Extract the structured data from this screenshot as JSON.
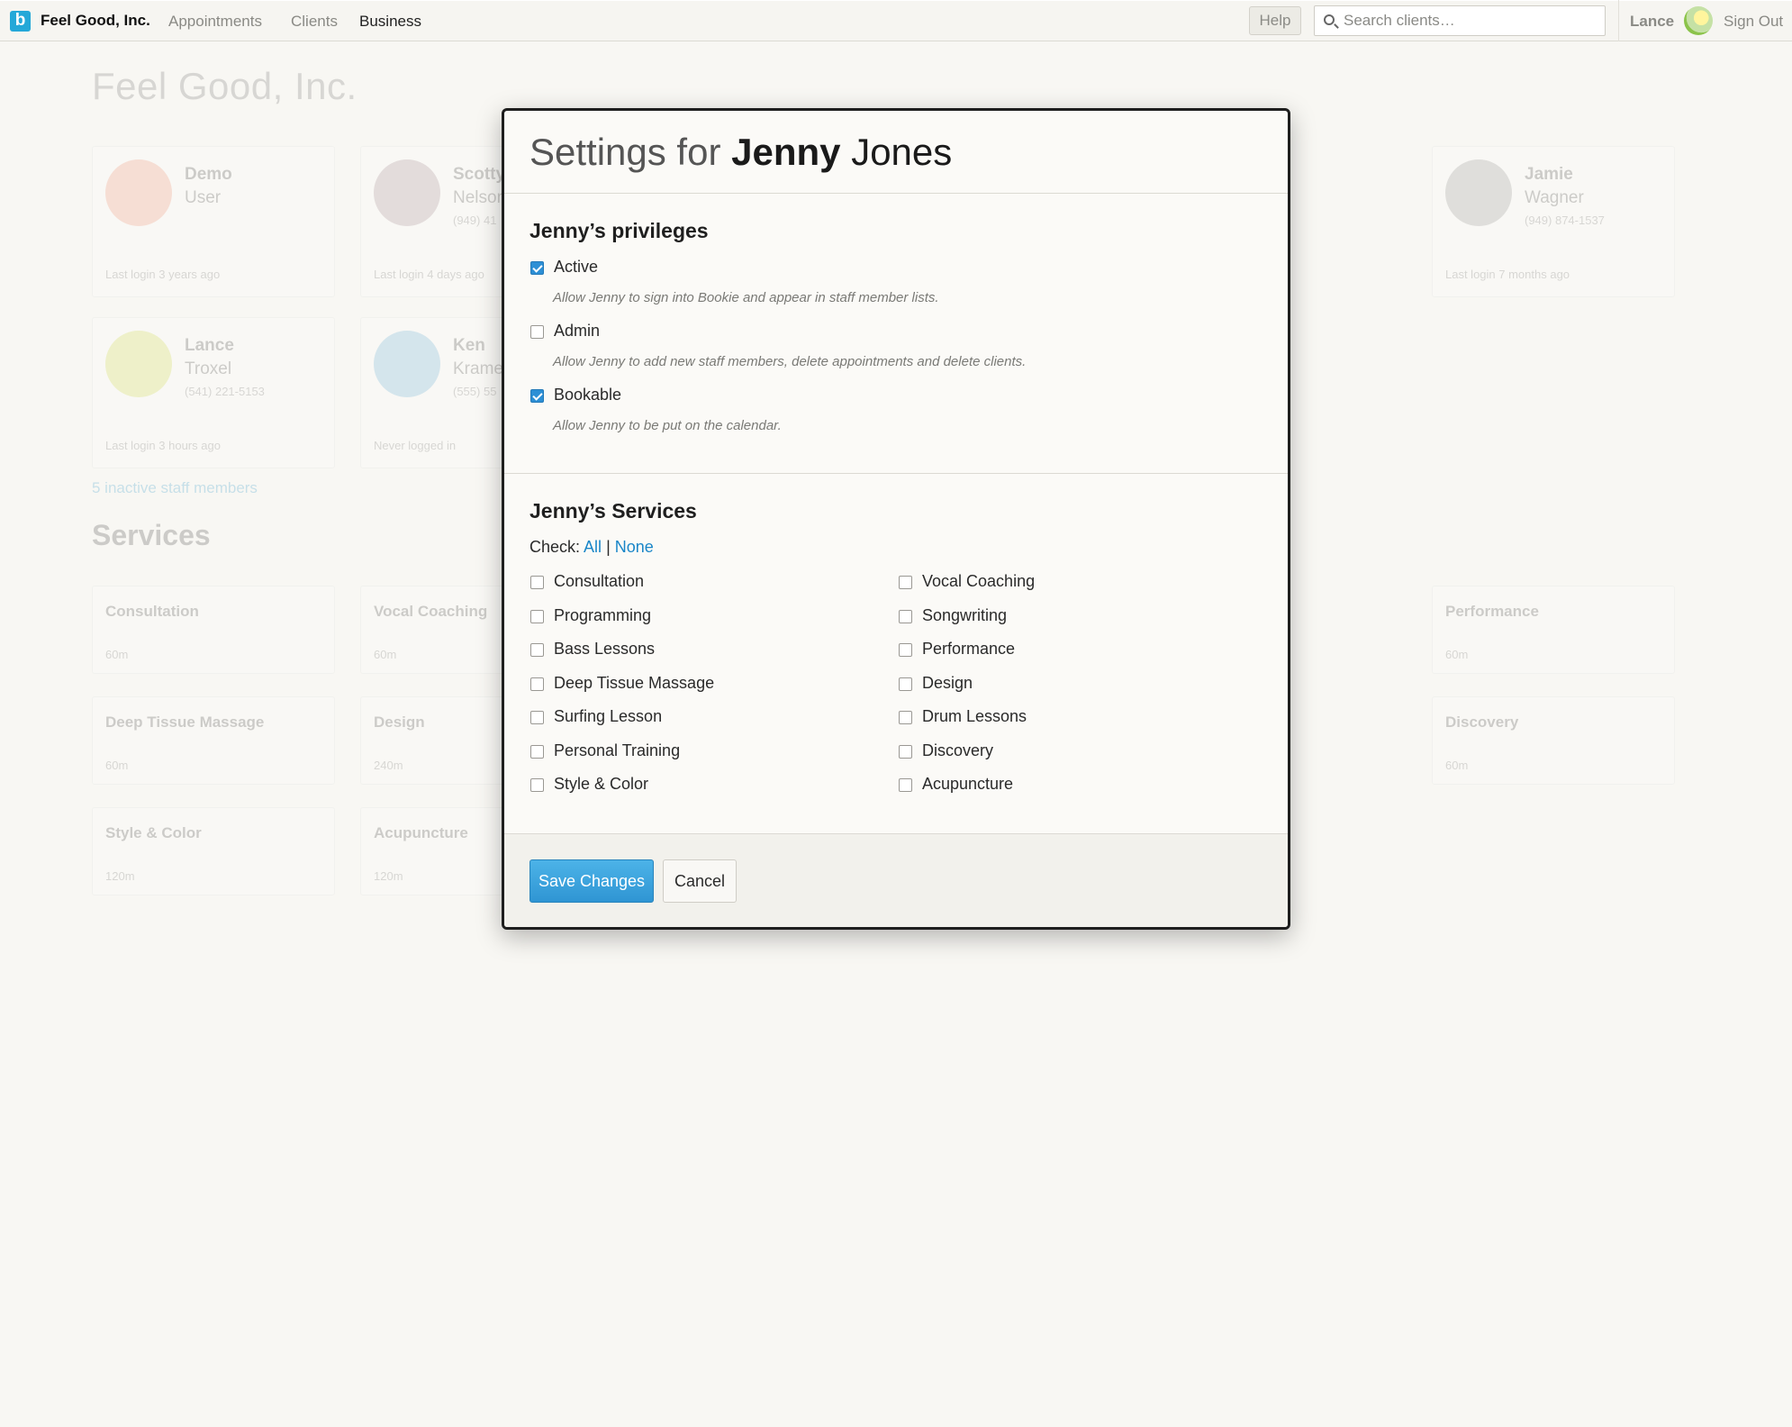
{
  "nav": {
    "logo": "b",
    "brand": "Feel Good, Inc.",
    "links": [
      "Appointments",
      "Clients",
      "Business"
    ],
    "help": "Help",
    "search_placeholder": "Search clients…",
    "user": "Lance",
    "signout": "Sign Out"
  },
  "background": {
    "title": "Feel Good, Inc.",
    "staff": [
      {
        "first": "Demo",
        "last": "User",
        "phone": "",
        "last_login": "Last login 3 years ago"
      },
      {
        "first": "Scotty",
        "last": "Nelson",
        "phone": "(949) 41",
        "last_login": "Last login 4 days ago"
      },
      {
        "first": "Jamie",
        "last": "Wagner",
        "phone": "(949) 874-1537",
        "last_login": "Last login 7 months ago"
      },
      {
        "first": "Lance",
        "last": "Troxel",
        "phone": "(541) 221-5153",
        "last_login": "Last login 3 hours ago"
      },
      {
        "first": "Ken",
        "last": "Kramer",
        "phone": "(555) 55",
        "last_login": "Never logged in"
      }
    ],
    "inactive_link": "5 inactive staff members",
    "services_heading": "Services",
    "services": [
      {
        "name": "Consultation",
        "duration": "60m"
      },
      {
        "name": "Vocal Coaching",
        "duration": "60m"
      },
      {
        "name": "Performance",
        "duration": "60m"
      },
      {
        "name": "Deep Tissue Massage",
        "duration": "60m"
      },
      {
        "name": "Design",
        "duration": "240m"
      },
      {
        "name": "Discovery",
        "duration": "60m"
      },
      {
        "name": "Style & Color",
        "duration": "120m"
      },
      {
        "name": "Acupuncture",
        "duration": "120m"
      }
    ]
  },
  "modal": {
    "title_prefix": "Settings for",
    "first_name": "Jenny",
    "last_name": "Jones",
    "privileges_heading": "Jenny’s privileges",
    "privileges": [
      {
        "label": "Active",
        "checked": true,
        "desc": "Allow Jenny to sign into Bookie and appear in staff member lists."
      },
      {
        "label": "Admin",
        "checked": false,
        "desc": "Allow Jenny to add new staff members, delete appointments and delete clients."
      },
      {
        "label": "Bookable",
        "checked": true,
        "desc": "Allow Jenny to be put on the calendar."
      }
    ],
    "services_heading": "Jenny’s Services",
    "check_label": "Check:",
    "check_all": "All",
    "check_sep": "|",
    "check_none": "None",
    "services_left": [
      "Consultation",
      "Programming",
      "Bass Lessons",
      "Deep Tissue Massage",
      "Surfing Lesson",
      "Personal Training",
      "Style & Color"
    ],
    "services_right": [
      "Vocal Coaching",
      "Songwriting",
      "Performance",
      "Design",
      "Drum Lessons",
      "Discovery",
      "Acupuncture"
    ],
    "save_label": "Save Changes",
    "cancel_label": "Cancel"
  }
}
